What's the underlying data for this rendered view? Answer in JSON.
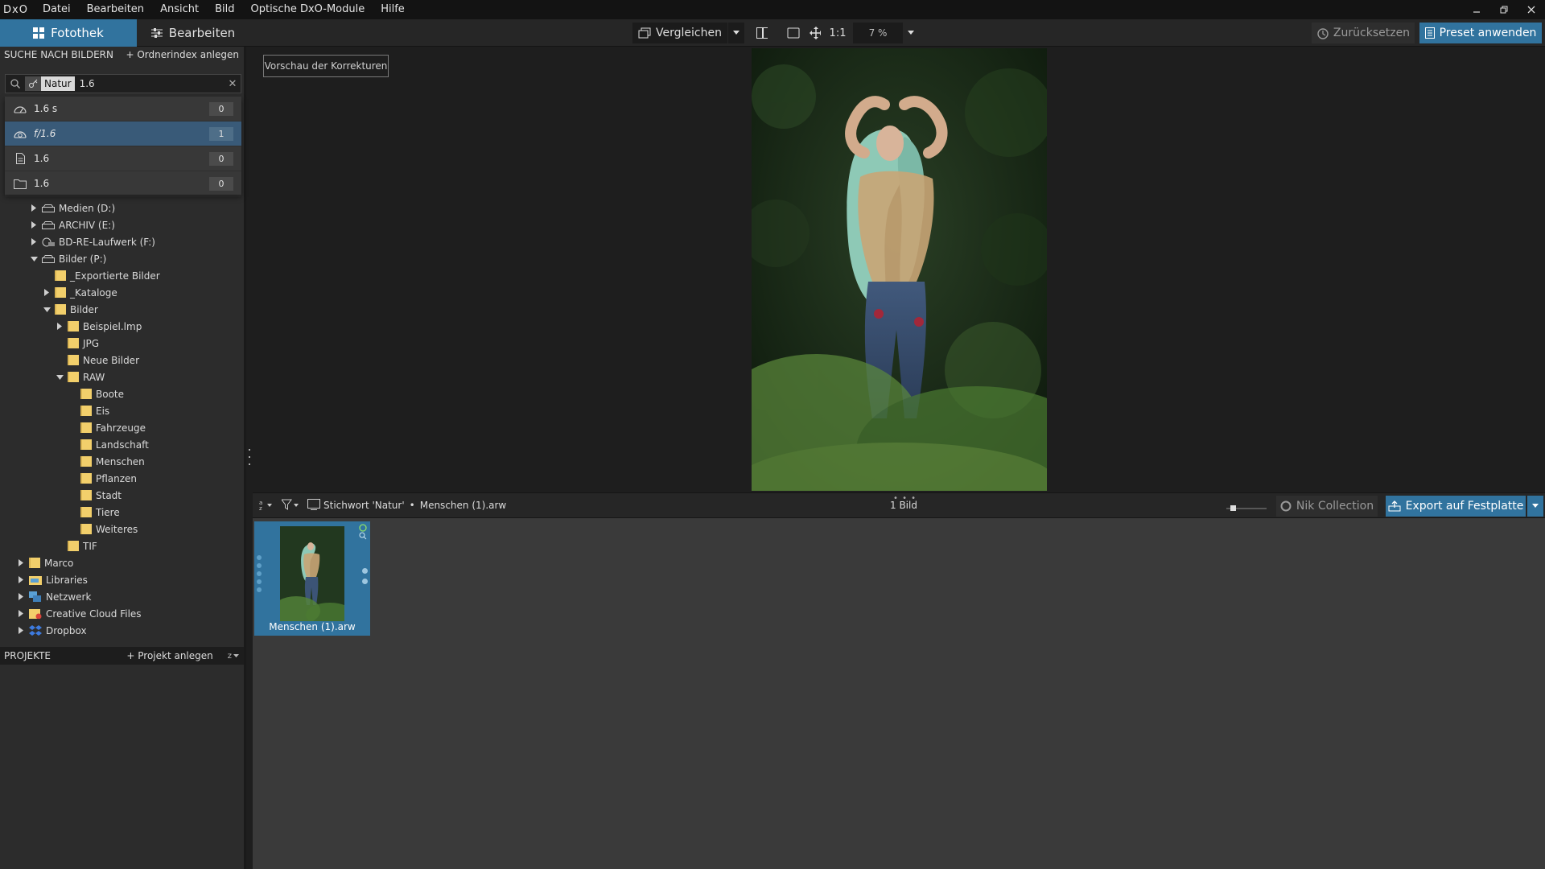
{
  "menu": {
    "logo": "DxO",
    "items": [
      "Datei",
      "Bearbeiten",
      "Ansicht",
      "Bild",
      "Optische DxO-Module",
      "Hilfe"
    ]
  },
  "toolbar": {
    "tab_library": "Fotothek",
    "tab_edit": "Bearbeiten",
    "compare": "Vergleichen",
    "one_to_one": "1:1",
    "zoom": "7 %",
    "reset": "Zurücksetzen",
    "preset": "Preset anwenden"
  },
  "left_panel": {
    "search_header": "SUCHE NACH BILDERN",
    "folder_index": "+ Ordnerindex anlegen",
    "search": {
      "keyword": "Natur",
      "text": "1.6"
    },
    "suggestions": [
      {
        "icon": "shutter-icon",
        "label": "1.6 s",
        "count": "0"
      },
      {
        "icon": "aperture-icon",
        "label": "f/1.6",
        "count": "1"
      },
      {
        "icon": "file-icon",
        "label": "1.6",
        "count": "0"
      },
      {
        "icon": "folder-icon",
        "label": "1.6",
        "count": "0"
      }
    ],
    "tree": [
      {
        "label": "Medien (D:)",
        "depth": 2,
        "type": "drive",
        "arrow": "right"
      },
      {
        "label": "ARCHIV (E:)",
        "depth": 2,
        "type": "drive",
        "arrow": "right"
      },
      {
        "label": "BD-RE-Laufwerk (F:)",
        "depth": 2,
        "type": "disc",
        "arrow": "right"
      },
      {
        "label": "Bilder (P:)",
        "depth": 2,
        "type": "drive",
        "arrow": "down"
      },
      {
        "label": "_Exportierte Bilder",
        "depth": 3,
        "type": "folder",
        "arrow": "none"
      },
      {
        "label": "_Kataloge",
        "depth": 3,
        "type": "folder",
        "arrow": "right"
      },
      {
        "label": "Bilder",
        "depth": 3,
        "type": "folder",
        "arrow": "down"
      },
      {
        "label": "Beispiel.lmp",
        "depth": 4,
        "type": "folder",
        "arrow": "right"
      },
      {
        "label": "JPG",
        "depth": 4,
        "type": "folder",
        "arrow": "none"
      },
      {
        "label": "Neue Bilder",
        "depth": 4,
        "type": "folder",
        "arrow": "none"
      },
      {
        "label": "RAW",
        "depth": 4,
        "type": "folder",
        "arrow": "down"
      },
      {
        "label": "Boote",
        "depth": 5,
        "type": "folder",
        "arrow": "none"
      },
      {
        "label": "Eis",
        "depth": 5,
        "type": "folder",
        "arrow": "none"
      },
      {
        "label": "Fahrzeuge",
        "depth": 5,
        "type": "folder",
        "arrow": "none"
      },
      {
        "label": "Landschaft",
        "depth": 5,
        "type": "folder",
        "arrow": "none"
      },
      {
        "label": "Menschen",
        "depth": 5,
        "type": "folder",
        "arrow": "none"
      },
      {
        "label": "Pflanzen",
        "depth": 5,
        "type": "folder",
        "arrow": "none"
      },
      {
        "label": "Stadt",
        "depth": 5,
        "type": "folder",
        "arrow": "none"
      },
      {
        "label": "Tiere",
        "depth": 5,
        "type": "folder",
        "arrow": "none"
      },
      {
        "label": "Weiteres",
        "depth": 5,
        "type": "folder",
        "arrow": "none"
      },
      {
        "label": "TIF",
        "depth": 4,
        "type": "folder",
        "arrow": "none"
      },
      {
        "label": "Marco",
        "depth": 1,
        "type": "folder",
        "arrow": "right"
      },
      {
        "label": "Libraries",
        "depth": 1,
        "type": "libraries",
        "arrow": "right"
      },
      {
        "label": "Netzwerk",
        "depth": 1,
        "type": "network",
        "arrow": "right"
      },
      {
        "label": "Creative Cloud Files",
        "depth": 1,
        "type": "creative-cloud",
        "arrow": "right"
      },
      {
        "label": "Dropbox",
        "depth": 1,
        "type": "dropbox",
        "arrow": "right"
      }
    ],
    "projects_header": "PROJEKTE",
    "add_project": "+ Projekt anlegen",
    "sort_label": "z"
  },
  "viewer": {
    "preview_button": "Vorschau der Korrekturen"
  },
  "strip_bar": {
    "keyword_filter": "Stichwort 'Natur'",
    "separator": "•",
    "filename": "Menschen (1).arw",
    "count": "1 Bild",
    "nik": "Nik Collection",
    "export": "Export auf Festplatte"
  },
  "filmstrip": {
    "thumbnails": [
      {
        "label": "Menschen (1).arw"
      }
    ]
  },
  "colors": {
    "accent": "#31739e",
    "panel": "#2c2c2c",
    "selection": "#395a78",
    "folder": "#f2cf6b"
  }
}
